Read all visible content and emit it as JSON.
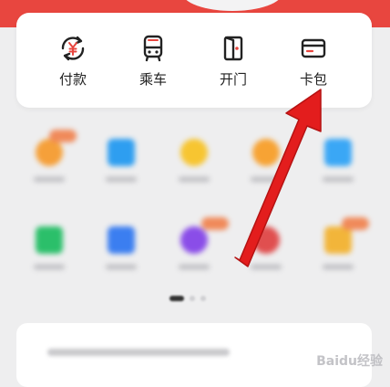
{
  "quick_actions": [
    {
      "label": "付款",
      "icon": "payment-yuan-icon"
    },
    {
      "label": "乘车",
      "icon": "bus-icon"
    },
    {
      "label": "开门",
      "icon": "door-icon"
    },
    {
      "label": "卡包",
      "icon": "card-wallet-icon"
    }
  ],
  "colors": {
    "brand_red": "#e8463f",
    "arrow_red": "#e31d1d",
    "text": "#222222"
  },
  "watermark": "Baidu经验"
}
